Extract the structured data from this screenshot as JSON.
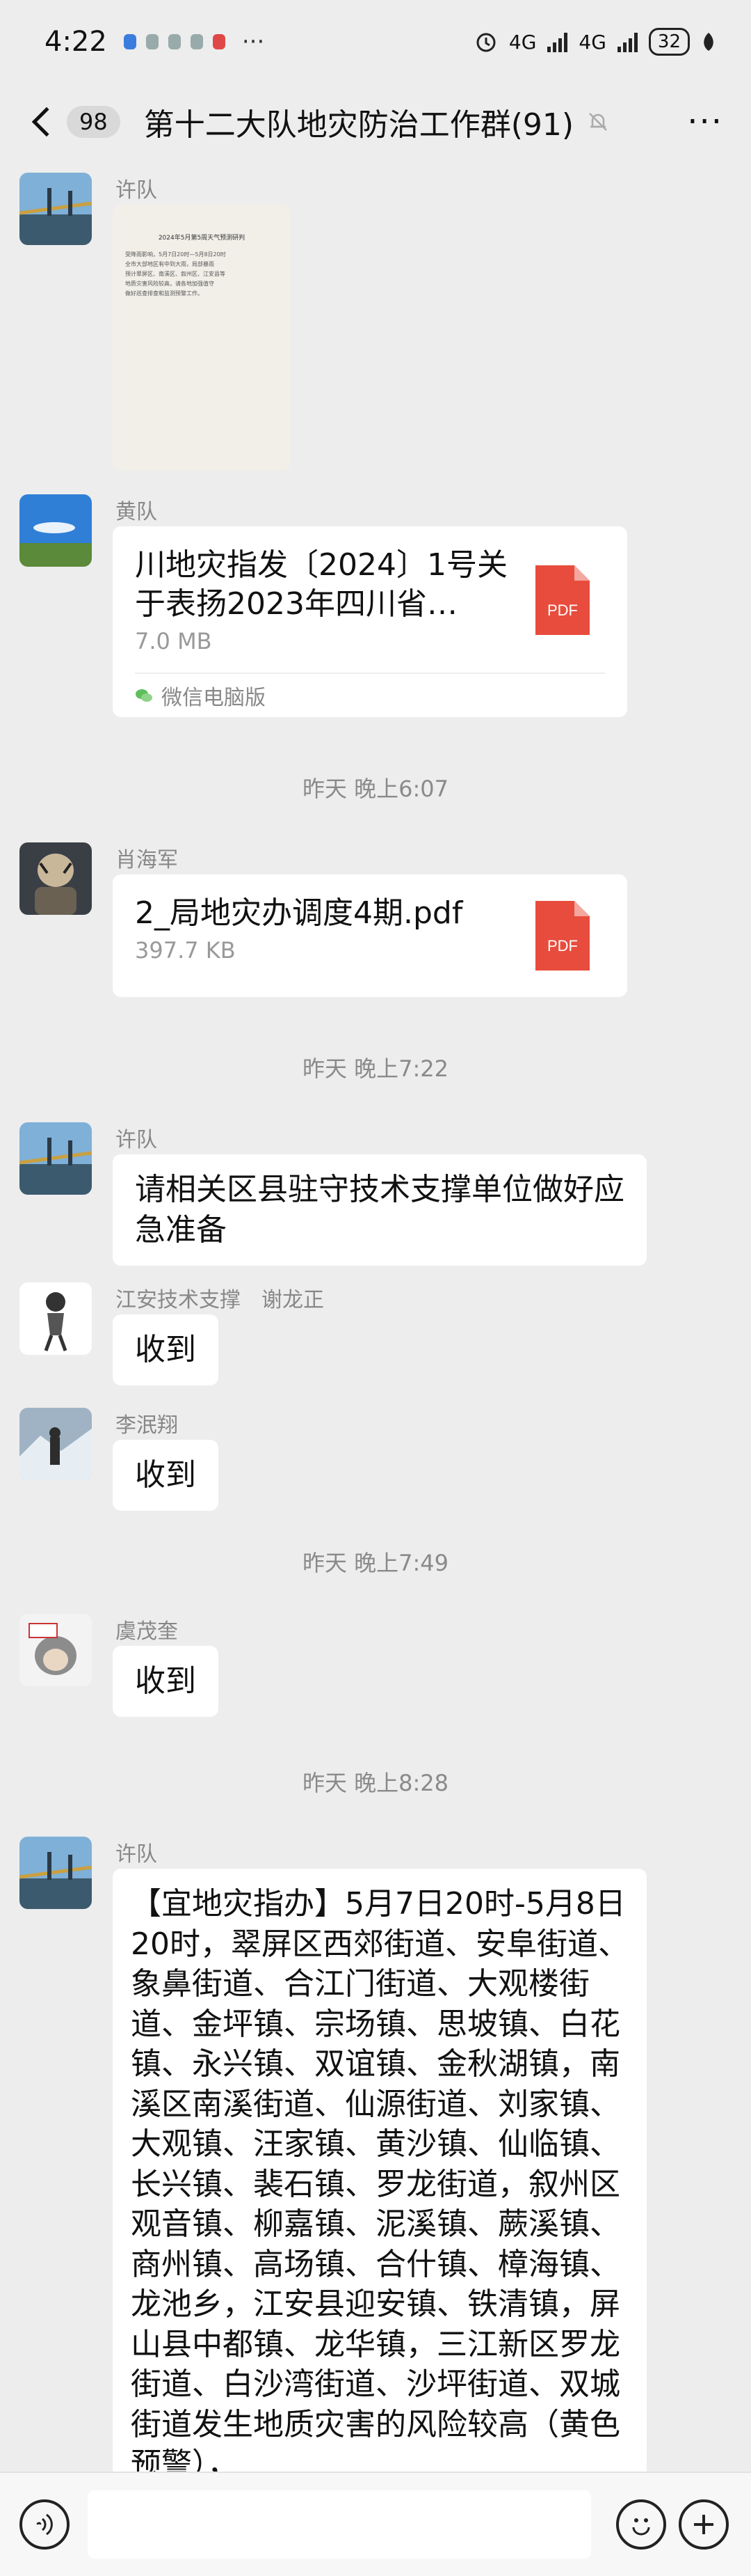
{
  "status": {
    "time": "4:22",
    "more": "···",
    "net1": "4G",
    "net2": "4G",
    "battery": "32"
  },
  "header": {
    "back_count": "98",
    "title": "第十二大队地灾防治工作群(91)",
    "more": "···"
  },
  "messages": {
    "m1": {
      "sender": "许队",
      "doc_title": "2024年5月第5周天气预测研判",
      "doc_lines": [
        "受降雨影响，5月7日20时—5月8日20时",
        "全市大部地区有中到大雨，局部暴雨",
        "预计翠屏区、南溪区、叙州区、江安县等",
        "地质灾害风险较高，请各地加强值守",
        "做好巡查排查和监测预警工作。"
      ]
    },
    "m2": {
      "sender": "黄队",
      "file_name": "川地灾指发〔2024〕1号关于表扬2023年四川省…",
      "file_size": "7.0 MB",
      "source": "微信电脑版",
      "file_type": "PDF"
    },
    "t1": "昨天 晚上6:07",
    "m3": {
      "sender": "肖海军",
      "file_name": "2_局地灾办调度4期.pdf",
      "file_size": "397.7 KB",
      "file_type": "PDF"
    },
    "t2": "昨天 晚上7:22",
    "m4": {
      "sender": "许队",
      "text": "请相关区县驻守技术支撑单位做好应急准备"
    },
    "m5": {
      "sender": "江安技术支撑　谢龙正",
      "text": "收到"
    },
    "m6": {
      "sender": "李泯翔",
      "text": "收到"
    },
    "t3": "昨天 晚上7:49",
    "m7": {
      "sender": "虞茂奎",
      "text": "收到"
    },
    "t4": "昨天 晚上8:28",
    "m8": {
      "sender": "许队",
      "text": "【宜地灾指办】5月7日20时-5月8日20时，翠屏区西郊街道、安阜街道、象鼻街道、合江门街道、大观楼街道、金坪镇、宗场镇、思坡镇、白花镇、永兴镇、双谊镇、金秋湖镇，南溪区南溪街道、仙源街道、刘家镇、大观镇、汪家镇、黄沙镇、仙临镇、长兴镇、裴石镇、罗龙街道，叙州区观音镇、柳嘉镇、泥溪镇、蕨溪镇、商州镇、高场镇、合什镇、樟海镇、龙池乡，江安县迎安镇、铁清镇，屏山县中都镇、龙华镇，三江新区罗龙街道、白沙湾街道、沙坪街道、双城街道发生地质灾害的风险较高（黄色预警），"
    }
  },
  "colors": {
    "background": "#ededed",
    "bubble": "#ffffff",
    "pdf": "#e84c3d",
    "muted_text": "#888888"
  }
}
